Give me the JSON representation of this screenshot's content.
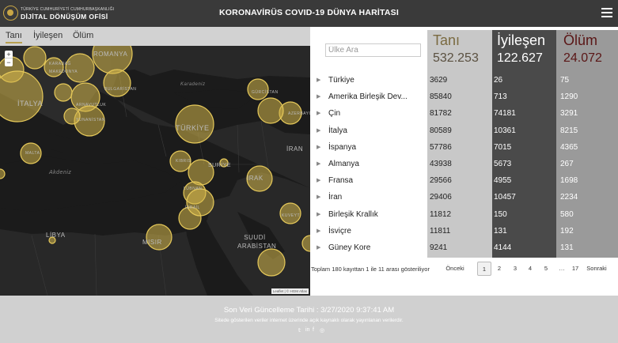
{
  "header": {
    "logo_line1": "TÜRKİYE CUMHURİYETİ CUMHURBAŞKANLIĞI",
    "logo_line2": "DİJİTAL DÖNÜŞÜM OFİSİ",
    "title": "KORONAVİRÜS COVID-19 DÜNYA HARİTASI",
    "menu_icon": "hamburger-menu-icon"
  },
  "map": {
    "tabs": [
      "Tanı",
      "İyileşen",
      "Ölüm"
    ],
    "active_tab": "Tanı",
    "zoom_in": "+",
    "zoom_out": "−",
    "attribution": "Leaflet | © HGM Atlas",
    "colors": {
      "land": "#262626",
      "sea": "#1a1a1a",
      "bubble": "#d4b74a"
    },
    "labels": [
      "ROMANYA",
      "KARADAĞ",
      "MAKEDONYA",
      "BULGARİSTAN",
      "İTALYA",
      "ARNAVUTLUK",
      "YUNANİSTAN",
      "Karadeniz",
      "GÜRCİSTAN",
      "AZERBAYCAN",
      "TÜRKİYE",
      "MALTA",
      "KIBRIS",
      "SURİYE",
      "IRAK",
      "İRAN",
      "Akdeniz",
      "LÜBNAN",
      "İSRAİL",
      "KUVEYT",
      "LİBYA",
      "MISIR",
      "SUUDİ ARABİSTAN"
    ]
  },
  "table": {
    "search_placeholder": "Ülke Ara",
    "headers": [
      {
        "label": "Tanı",
        "value": "532.253"
      },
      {
        "label": "İyileşen",
        "value": "122.627"
      },
      {
        "label": "Ölüm",
        "value": "24.072"
      }
    ],
    "rows": [
      {
        "country": "Türkiye",
        "tani": "3629",
        "iyilesen": "26",
        "olum": "75"
      },
      {
        "country": "Amerika Birleşik Dev...",
        "tani": "85840",
        "iyilesen": "713",
        "olum": "1290"
      },
      {
        "country": "Çin",
        "tani": "81782",
        "iyilesen": "74181",
        "olum": "3291"
      },
      {
        "country": "İtalya",
        "tani": "80589",
        "iyilesen": "10361",
        "olum": "8215"
      },
      {
        "country": "İspanya",
        "tani": "57786",
        "iyilesen": "7015",
        "olum": "4365"
      },
      {
        "country": "Almanya",
        "tani": "43938",
        "iyilesen": "5673",
        "olum": "267"
      },
      {
        "country": "Fransa",
        "tani": "29566",
        "iyilesen": "4955",
        "olum": "1698"
      },
      {
        "country": "İran",
        "tani": "29406",
        "iyilesen": "10457",
        "olum": "2234"
      },
      {
        "country": "Birleşik Krallık",
        "tani": "11812",
        "iyilesen": "150",
        "olum": "580"
      },
      {
        "country": "İsviçre",
        "tani": "11811",
        "iyilesen": "131",
        "olum": "192"
      },
      {
        "country": "Güney Kore",
        "tani": "9241",
        "iyilesen": "4144",
        "olum": "131"
      }
    ],
    "info": "Toplam 180 kayıttan 1 ile 11 arası gösteriliyor",
    "pager": {
      "prev": "Önceki",
      "pages": [
        "1",
        "2",
        "3",
        "4",
        "5",
        "…",
        "17"
      ],
      "current": "1",
      "next": "Sonraki"
    }
  },
  "footer": {
    "date": "Son Veri Güncelleme Tarihi : 3/27/2020 9:37:41 AM",
    "note": "Sitede gösterilen veriler internet üzerinde açık kaynaklı olarak yayınlanan verilerdir.",
    "social_icons": [
      "twitter-icon",
      "linkedin-icon",
      "facebook-icon",
      "instagram-icon"
    ],
    "social_glyphs": [
      "𝕥",
      "in",
      "f",
      "◎"
    ]
  }
}
